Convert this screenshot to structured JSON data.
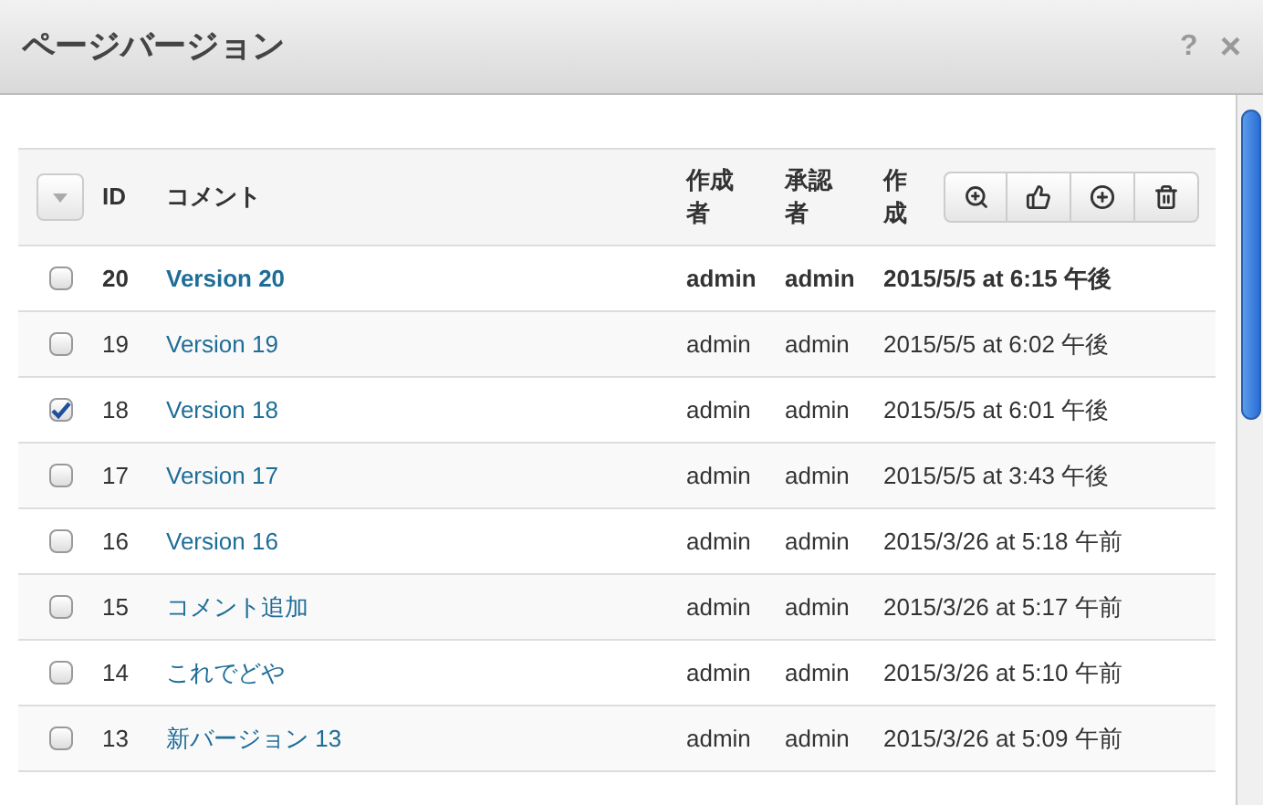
{
  "window": {
    "title": "ページバージョン",
    "help": "?",
    "close": "×"
  },
  "table": {
    "columns": {
      "id": "ID",
      "comment": "コメント",
      "author": "作成者",
      "approver": "承認者",
      "created": "作成"
    },
    "rows": [
      {
        "id": "20",
        "comment": "Version 20",
        "author": "admin",
        "approver": "admin",
        "date": "2015/5/5 at 6:15 午後",
        "checked": false,
        "current": true
      },
      {
        "id": "19",
        "comment": "Version 19",
        "author": "admin",
        "approver": "admin",
        "date": "2015/5/5 at 6:02 午後",
        "checked": false,
        "current": false
      },
      {
        "id": "18",
        "comment": "Version 18",
        "author": "admin",
        "approver": "admin",
        "date": "2015/5/5 at 6:01 午後",
        "checked": true,
        "current": false
      },
      {
        "id": "17",
        "comment": "Version 17",
        "author": "admin",
        "approver": "admin",
        "date": "2015/5/5 at 3:43 午後",
        "checked": false,
        "current": false
      },
      {
        "id": "16",
        "comment": "Version 16",
        "author": "admin",
        "approver": "admin",
        "date": "2015/3/26 at 5:18 午前",
        "checked": false,
        "current": false
      },
      {
        "id": "15",
        "comment": "コメント追加",
        "author": "admin",
        "approver": "admin",
        "date": "2015/3/26 at 5:17 午前",
        "checked": false,
        "current": false
      },
      {
        "id": "14",
        "comment": "これでどや",
        "author": "admin",
        "approver": "admin",
        "date": "2015/3/26 at 5:10 午前",
        "checked": false,
        "current": false
      },
      {
        "id": "13",
        "comment": "新バージョン 13",
        "author": "admin",
        "approver": "admin",
        "date": "2015/3/26 at 5:09 午前",
        "checked": false,
        "current": false
      }
    ]
  }
}
